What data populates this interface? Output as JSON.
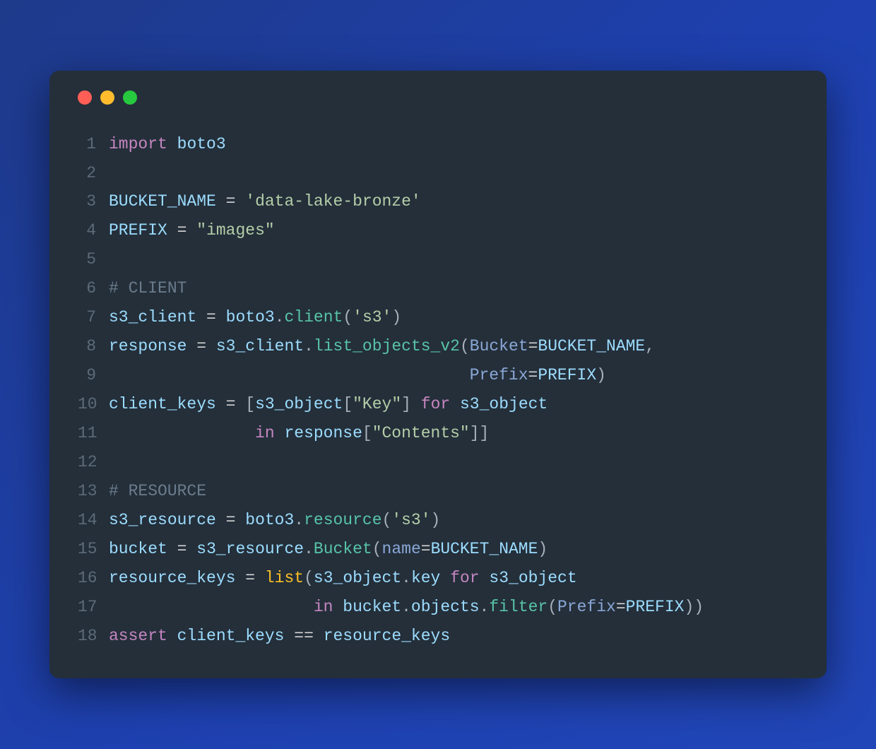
{
  "window": {
    "traffic_lights": [
      "red",
      "yellow",
      "green"
    ]
  },
  "code": {
    "lines": [
      {
        "n": "1",
        "tokens": [
          {
            "c": "kw",
            "t": "import"
          },
          {
            "c": "plain",
            "t": " "
          },
          {
            "c": "var",
            "t": "boto3"
          }
        ]
      },
      {
        "n": "2",
        "tokens": []
      },
      {
        "n": "3",
        "tokens": [
          {
            "c": "var",
            "t": "BUCKET_NAME"
          },
          {
            "c": "plain",
            "t": " "
          },
          {
            "c": "op",
            "t": "="
          },
          {
            "c": "plain",
            "t": " "
          },
          {
            "c": "str",
            "t": "'data-lake-bronze'"
          }
        ]
      },
      {
        "n": "4",
        "tokens": [
          {
            "c": "var",
            "t": "PREFIX"
          },
          {
            "c": "plain",
            "t": " "
          },
          {
            "c": "op",
            "t": "="
          },
          {
            "c": "plain",
            "t": " "
          },
          {
            "c": "str",
            "t": "\"images\""
          }
        ]
      },
      {
        "n": "5",
        "tokens": []
      },
      {
        "n": "6",
        "tokens": [
          {
            "c": "comment",
            "t": "# CLIENT"
          }
        ]
      },
      {
        "n": "7",
        "tokens": [
          {
            "c": "var",
            "t": "s3_client"
          },
          {
            "c": "plain",
            "t": " "
          },
          {
            "c": "op",
            "t": "="
          },
          {
            "c": "plain",
            "t": " "
          },
          {
            "c": "var",
            "t": "boto3"
          },
          {
            "c": "punct",
            "t": "."
          },
          {
            "c": "attr",
            "t": "client"
          },
          {
            "c": "punct",
            "t": "("
          },
          {
            "c": "str",
            "t": "'s3'"
          },
          {
            "c": "punct",
            "t": ")"
          }
        ]
      },
      {
        "n": "8",
        "tokens": [
          {
            "c": "var",
            "t": "response"
          },
          {
            "c": "plain",
            "t": " "
          },
          {
            "c": "op",
            "t": "="
          },
          {
            "c": "plain",
            "t": " "
          },
          {
            "c": "var",
            "t": "s3_client"
          },
          {
            "c": "punct",
            "t": "."
          },
          {
            "c": "attr",
            "t": "list_objects_v2"
          },
          {
            "c": "punct",
            "t": "("
          },
          {
            "c": "param",
            "t": "Bucket"
          },
          {
            "c": "op",
            "t": "="
          },
          {
            "c": "var",
            "t": "BUCKET_NAME"
          },
          {
            "c": "punct",
            "t": ","
          }
        ]
      },
      {
        "n": "9",
        "tokens": [
          {
            "c": "plain",
            "t": "                                     "
          },
          {
            "c": "param",
            "t": "Prefix"
          },
          {
            "c": "op",
            "t": "="
          },
          {
            "c": "var",
            "t": "PREFIX"
          },
          {
            "c": "punct",
            "t": ")"
          }
        ]
      },
      {
        "n": "10",
        "tokens": [
          {
            "c": "var",
            "t": "client_keys"
          },
          {
            "c": "plain",
            "t": " "
          },
          {
            "c": "op",
            "t": "="
          },
          {
            "c": "plain",
            "t": " "
          },
          {
            "c": "punct",
            "t": "["
          },
          {
            "c": "var",
            "t": "s3_object"
          },
          {
            "c": "punct",
            "t": "["
          },
          {
            "c": "str",
            "t": "\"Key\""
          },
          {
            "c": "punct",
            "t": "]"
          },
          {
            "c": "plain",
            "t": " "
          },
          {
            "c": "kw",
            "t": "for"
          },
          {
            "c": "plain",
            "t": " "
          },
          {
            "c": "var",
            "t": "s3_object"
          }
        ]
      },
      {
        "n": "11",
        "tokens": [
          {
            "c": "plain",
            "t": "               "
          },
          {
            "c": "kw",
            "t": "in"
          },
          {
            "c": "plain",
            "t": " "
          },
          {
            "c": "var",
            "t": "response"
          },
          {
            "c": "punct",
            "t": "["
          },
          {
            "c": "str",
            "t": "\"Contents\""
          },
          {
            "c": "punct",
            "t": "]]"
          }
        ]
      },
      {
        "n": "12",
        "tokens": []
      },
      {
        "n": "13",
        "tokens": [
          {
            "c": "comment",
            "t": "# RESOURCE"
          }
        ]
      },
      {
        "n": "14",
        "tokens": [
          {
            "c": "var",
            "t": "s3_resource"
          },
          {
            "c": "plain",
            "t": " "
          },
          {
            "c": "op",
            "t": "="
          },
          {
            "c": "plain",
            "t": " "
          },
          {
            "c": "var",
            "t": "boto3"
          },
          {
            "c": "punct",
            "t": "."
          },
          {
            "c": "attr",
            "t": "resource"
          },
          {
            "c": "punct",
            "t": "("
          },
          {
            "c": "str",
            "t": "'s3'"
          },
          {
            "c": "punct",
            "t": ")"
          }
        ]
      },
      {
        "n": "15",
        "tokens": [
          {
            "c": "var",
            "t": "bucket"
          },
          {
            "c": "plain",
            "t": " "
          },
          {
            "c": "op",
            "t": "="
          },
          {
            "c": "plain",
            "t": " "
          },
          {
            "c": "var",
            "t": "s3_resource"
          },
          {
            "c": "punct",
            "t": "."
          },
          {
            "c": "attr",
            "t": "Bucket"
          },
          {
            "c": "punct",
            "t": "("
          },
          {
            "c": "param",
            "t": "name"
          },
          {
            "c": "op",
            "t": "="
          },
          {
            "c": "var",
            "t": "BUCKET_NAME"
          },
          {
            "c": "punct",
            "t": ")"
          }
        ]
      },
      {
        "n": "16",
        "tokens": [
          {
            "c": "var",
            "t": "resource_keys"
          },
          {
            "c": "plain",
            "t": " "
          },
          {
            "c": "op",
            "t": "="
          },
          {
            "c": "plain",
            "t": " "
          },
          {
            "c": "func",
            "t": "list"
          },
          {
            "c": "punct",
            "t": "("
          },
          {
            "c": "var",
            "t": "s3_object"
          },
          {
            "c": "punct",
            "t": "."
          },
          {
            "c": "var",
            "t": "key"
          },
          {
            "c": "plain",
            "t": " "
          },
          {
            "c": "kw",
            "t": "for"
          },
          {
            "c": "plain",
            "t": " "
          },
          {
            "c": "var",
            "t": "s3_object"
          }
        ]
      },
      {
        "n": "17",
        "tokens": [
          {
            "c": "plain",
            "t": "                     "
          },
          {
            "c": "kw",
            "t": "in"
          },
          {
            "c": "plain",
            "t": " "
          },
          {
            "c": "var",
            "t": "bucket"
          },
          {
            "c": "punct",
            "t": "."
          },
          {
            "c": "var",
            "t": "objects"
          },
          {
            "c": "punct",
            "t": "."
          },
          {
            "c": "attr",
            "t": "filter"
          },
          {
            "c": "punct",
            "t": "("
          },
          {
            "c": "param",
            "t": "Prefix"
          },
          {
            "c": "op",
            "t": "="
          },
          {
            "c": "var",
            "t": "PREFIX"
          },
          {
            "c": "punct",
            "t": "))"
          }
        ]
      },
      {
        "n": "18",
        "tokens": [
          {
            "c": "kw",
            "t": "assert"
          },
          {
            "c": "plain",
            "t": " "
          },
          {
            "c": "var",
            "t": "client_keys"
          },
          {
            "c": "plain",
            "t": " "
          },
          {
            "c": "op",
            "t": "=="
          },
          {
            "c": "plain",
            "t": " "
          },
          {
            "c": "var",
            "t": "resource_keys"
          }
        ]
      }
    ]
  }
}
